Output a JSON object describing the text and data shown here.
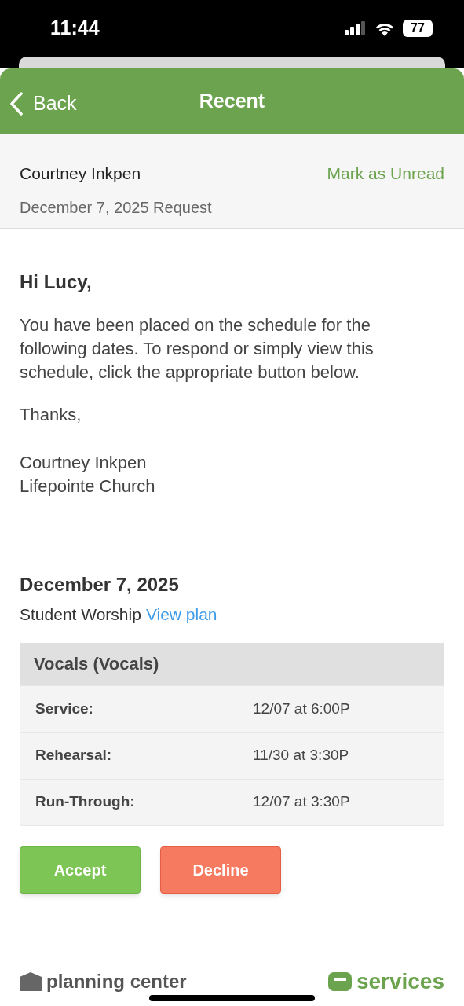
{
  "status_bar": {
    "time": "11:44",
    "battery": "77"
  },
  "nav": {
    "back": "Back",
    "title": "Recent"
  },
  "request": {
    "sender": "Courtney Inkpen",
    "subtitle": "December 7, 2025 Request",
    "action": "Mark as Unread"
  },
  "message": {
    "greeting": "Hi Lucy,",
    "body": "You have been placed on the schedule for the following dates. To respond or simply view this schedule, click the appropriate button below.",
    "closing": "Thanks,",
    "signature": [
      "Courtney Inkpen",
      "Lifepointe Church"
    ]
  },
  "plan": {
    "date": "December 7, 2025",
    "service_type": "Student Worship",
    "link": "View plan"
  },
  "position": {
    "title": "Vocals (Vocals)",
    "rows": [
      {
        "label": "Service:",
        "time": "12/07 at 6:00P"
      },
      {
        "label": "Rehearsal:",
        "time": "11/30 at 3:30P"
      },
      {
        "label": "Run-Through:",
        "time": "12/07 at 3:30P"
      }
    ]
  },
  "buttons": [
    {
      "label": "Accept",
      "kind": "accept"
    },
    {
      "label": "Decline",
      "kind": "decline"
    }
  ],
  "footer": {
    "brand": "planning center",
    "product": "services"
  }
}
